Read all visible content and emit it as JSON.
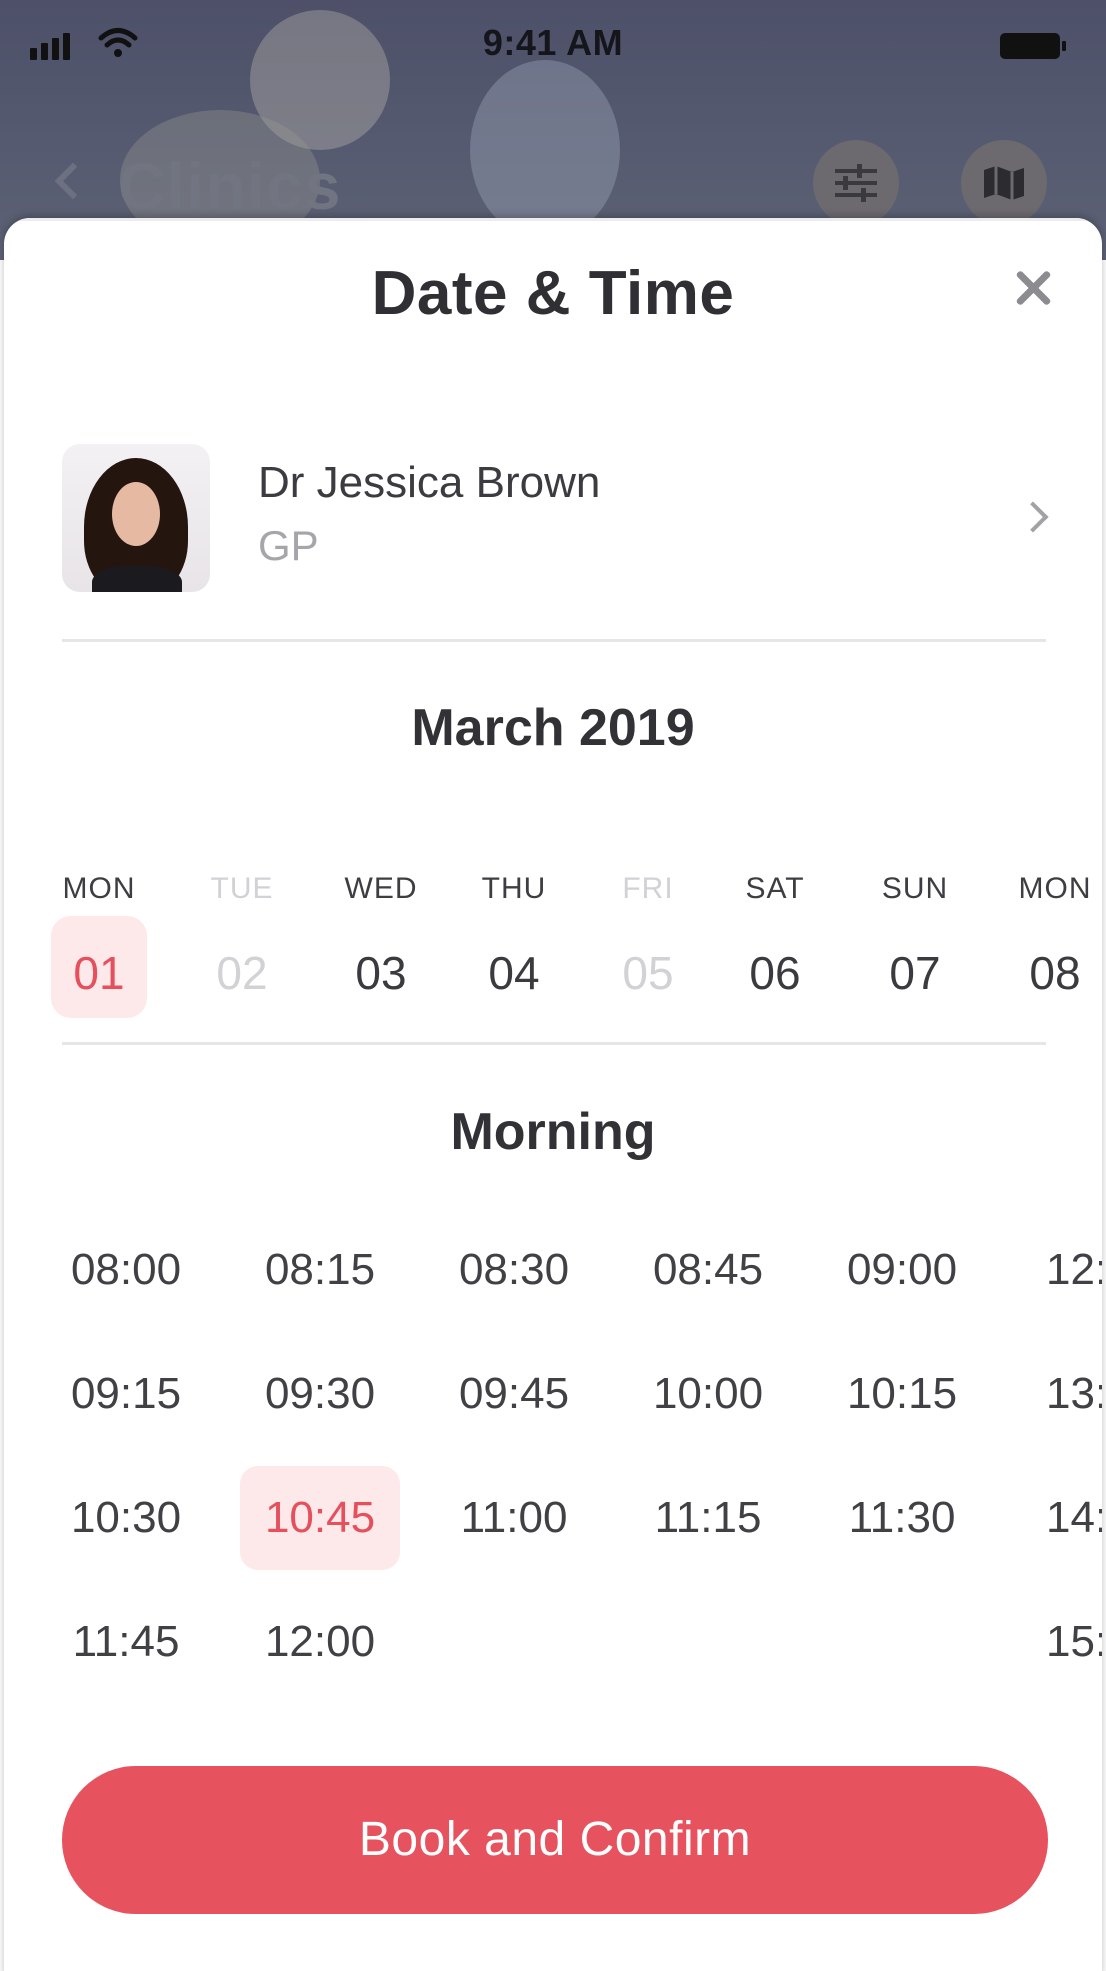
{
  "status_bar": {
    "time": "9:41 AM",
    "icons": [
      "signal-icon",
      "wifi-icon",
      "battery-icon"
    ]
  },
  "background_screen": {
    "title": "Clinics",
    "icons": [
      "back-icon",
      "filter-icon",
      "map-icon"
    ]
  },
  "modal": {
    "title": "Date & Time",
    "close_icon": "close-icon"
  },
  "doctor": {
    "name": "Dr Jessica Brown",
    "role": "GP",
    "chevron_icon": "chevron-right-icon"
  },
  "calendar": {
    "month": "March 2019",
    "days": [
      {
        "name": "MON",
        "number": "01",
        "state": "selected"
      },
      {
        "name": "TUE",
        "number": "02",
        "state": "disabled"
      },
      {
        "name": "WED",
        "number": "03",
        "state": "available"
      },
      {
        "name": "THU",
        "number": "04",
        "state": "available"
      },
      {
        "name": "FRI",
        "number": "05",
        "state": "disabled"
      },
      {
        "name": "SAT",
        "number": "06",
        "state": "available"
      },
      {
        "name": "SUN",
        "number": "07",
        "state": "available"
      },
      {
        "name": "MON",
        "number": "08",
        "state": "available"
      }
    ]
  },
  "times": {
    "period": "Morning",
    "selected": "10:45",
    "slots": [
      "08:00",
      "08:15",
      "08:30",
      "08:45",
      "09:00",
      "09:15",
      "09:30",
      "09:45",
      "10:00",
      "10:15",
      "10:30",
      "10:45",
      "11:00",
      "11:15",
      "11:30",
      "11:45",
      "12:00"
    ],
    "partial_slots": [
      "12:",
      "13:",
      "14:",
      "15:"
    ]
  },
  "actions": {
    "confirm_label": "Book and Confirm"
  },
  "colors": {
    "accent": "#e6525d",
    "selected_bg": "#fde8ea",
    "text_dark": "#323236",
    "text_muted": "#a6a6aa"
  }
}
